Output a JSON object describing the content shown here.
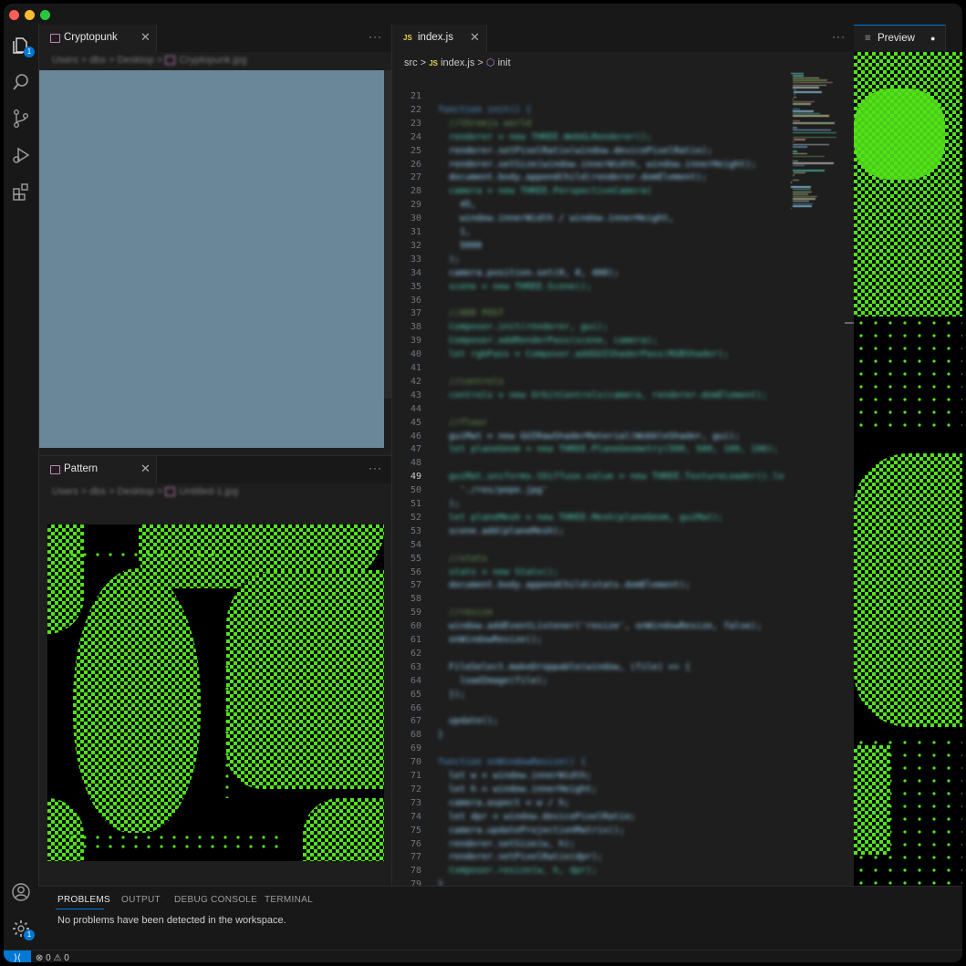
{
  "colors": {
    "accent": "#0078d4",
    "green": "#52e21a",
    "image_fill": "#6a8799",
    "traffic_red": "#ff5f57",
    "traffic_yellow": "#febc2e",
    "traffic_green": "#28c840"
  },
  "activity_bar": {
    "items": [
      {
        "name": "explorer-icon",
        "badge": "1"
      },
      {
        "name": "search-icon"
      },
      {
        "name": "source-control-icon"
      },
      {
        "name": "run-debug-icon"
      },
      {
        "name": "extensions-icon"
      }
    ],
    "bottom": [
      {
        "name": "account-icon"
      },
      {
        "name": "settings-gear-icon",
        "badge": "1"
      }
    ]
  },
  "top_left_group": {
    "tab_label": "Cryptopunk",
    "close": "✕",
    "more": "···",
    "breadcrumb": [
      "Users",
      "dbs",
      "Desktop",
      "Cryptopunk.jpg"
    ]
  },
  "bottom_left_group": {
    "tab_label": "Pattern",
    "close": "✕",
    "more": "···",
    "breadcrumb": [
      "Users",
      "dbs",
      "Desktop",
      "Untitled-1.jpg"
    ]
  },
  "editor": {
    "tab_label": "index.js",
    "tab_lang": "JS",
    "close": "✕",
    "more": "···",
    "breadcrumb": {
      "folder": "src",
      "lang": "JS",
      "file": "index.js",
      "symbol": "init"
    },
    "active_line": 49,
    "lines": [
      {
        "n": 21,
        "t": ""
      },
      {
        "n": 22,
        "t": "function init() {"
      },
      {
        "n": 23,
        "t": "  //threejs world"
      },
      {
        "n": 24,
        "t": "  renderer = new THREE.WebGLRenderer();"
      },
      {
        "n": 25,
        "t": "  renderer.setPixelRatio(window.devicePixelRatio);"
      },
      {
        "n": 26,
        "t": "  renderer.setSize(window.innerWidth, window.innerHeight);"
      },
      {
        "n": 27,
        "t": "  document.body.appendChild(renderer.domElement);"
      },
      {
        "n": 28,
        "t": "  camera = new THREE.PerspectiveCamera("
      },
      {
        "n": 29,
        "t": "    45,"
      },
      {
        "n": 30,
        "t": "    window.innerWidth / window.innerHeight,"
      },
      {
        "n": 31,
        "t": "    1,"
      },
      {
        "n": 32,
        "t": "    5000"
      },
      {
        "n": 33,
        "t": "  );"
      },
      {
        "n": 34,
        "t": "  camera.position.set(0, 0, 400);"
      },
      {
        "n": 35,
        "t": "  scene = new THREE.Scene();"
      },
      {
        "n": 36,
        "t": ""
      },
      {
        "n": 37,
        "t": "  //ADD POST"
      },
      {
        "n": 38,
        "t": "  Composer.init(renderer, gui);"
      },
      {
        "n": 39,
        "t": "  Composer.addRenderPass(scene, camera);"
      },
      {
        "n": 40,
        "t": "  let rgbPass = Composer.addGUIShaderPass(RGBShader);"
      },
      {
        "n": 41,
        "t": ""
      },
      {
        "n": 42,
        "t": "  //controls"
      },
      {
        "n": 43,
        "t": "  controls = new OrbitControls(camera, renderer.domElement);"
      },
      {
        "n": 44,
        "t": ""
      },
      {
        "n": 45,
        "t": "  //floor"
      },
      {
        "n": 46,
        "t": "  guiMat = new GUIRawShaderMaterial(WobbleShader, gui);"
      },
      {
        "n": 47,
        "t": "  let planeGeom = new THREE.PlaneGeometry(500, 500, 100, 100);"
      },
      {
        "n": 48,
        "t": ""
      },
      {
        "n": 49,
        "t": "  guiMat.uniforms.tDiffuse.value = new THREE.TextureLoader().lo"
      },
      {
        "n": 50,
        "t": "    './res/pepe.jpg'"
      },
      {
        "n": 51,
        "t": "  );"
      },
      {
        "n": 52,
        "t": "  let planeMesh = new THREE.Mesh(planeGeom, guiMat);"
      },
      {
        "n": 53,
        "t": "  scene.add(planeMesh);"
      },
      {
        "n": 54,
        "t": ""
      },
      {
        "n": 55,
        "t": "  //stats"
      },
      {
        "n": 56,
        "t": "  stats = new Stats();"
      },
      {
        "n": 57,
        "t": "  document.body.appendChild(stats.domElement);"
      },
      {
        "n": 58,
        "t": ""
      },
      {
        "n": 59,
        "t": "  //resize"
      },
      {
        "n": 60,
        "t": "  window.addEventListener('resize', onWindowResize, false);"
      },
      {
        "n": 61,
        "t": "  onWindowResize();"
      },
      {
        "n": 62,
        "t": ""
      },
      {
        "n": 63,
        "t": "  FileSelect.makeDroppable(window, (file) => {"
      },
      {
        "n": 64,
        "t": "    loadImage(file);"
      },
      {
        "n": 65,
        "t": "  });"
      },
      {
        "n": 66,
        "t": ""
      },
      {
        "n": 67,
        "t": "  update();"
      },
      {
        "n": 68,
        "t": "}"
      },
      {
        "n": 69,
        "t": ""
      },
      {
        "n": 70,
        "t": "function onWindowResize() {"
      },
      {
        "n": 71,
        "t": "  let w = window.innerWidth;"
      },
      {
        "n": 72,
        "t": "  let h = window.innerHeight;"
      },
      {
        "n": 73,
        "t": "  camera.aspect = w / h;"
      },
      {
        "n": 74,
        "t": "  let dpr = window.devicePixelRatio;"
      },
      {
        "n": 75,
        "t": "  camera.updateProjectionMatrix();"
      },
      {
        "n": 76,
        "t": "  renderer.setSize(w, h);"
      },
      {
        "n": 77,
        "t": "  renderer.setPixelRatio(dpr);"
      },
      {
        "n": 78,
        "t": "  Composer.resize(w, h, dpr);"
      },
      {
        "n": 79,
        "t": "}"
      },
      {
        "n": 80,
        "t": ""
      }
    ]
  },
  "preview": {
    "tab_label": "Preview",
    "tab_glyph": "≡",
    "dirty_dot": "●"
  },
  "panel": {
    "tabs": [
      "PROBLEMS",
      "OUTPUT",
      "DEBUG CONSOLE",
      "TERMINAL"
    ],
    "active_tab": 0,
    "message": "No problems have been detected in the workspace."
  },
  "status_bar": {
    "remote_icon": "remote-icon",
    "errors": "0",
    "warnings": "0"
  }
}
